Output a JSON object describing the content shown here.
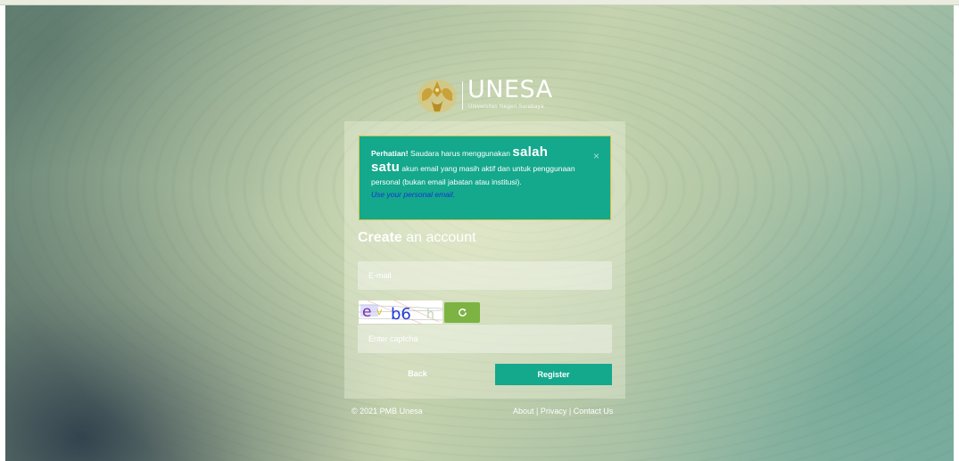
{
  "brand": {
    "name": "UNESA",
    "subtitle": "Universitas Negeri Surabaya"
  },
  "alert": {
    "prefix_bold": "Perhatian!",
    "text1": " Saudara harus menggunakan ",
    "emphasis1": "salah",
    "emphasis2": "satu",
    "text2": " akun email yang masih aktif dan untuk penggunaan personal (bukan email jabatan atau institusi).",
    "hint": "Use your personal email.",
    "close_label": "×"
  },
  "form": {
    "title_bold": "Create",
    "title_rest": " an account",
    "email_placeholder": "E-mail",
    "captcha_text": "e v b6 h",
    "refresh_icon": "refresh-icon",
    "captcha_placeholder": "Enter captcha",
    "back_label": "Back",
    "register_label": "Register"
  },
  "footer": {
    "copyright": "© 2021 PMB Unesa",
    "links": [
      "About",
      "Privacy",
      "Contact Us"
    ],
    "separator": " | "
  },
  "colors": {
    "accent": "#14a88c",
    "refresh": "#7cb342",
    "hint": "#1637d6"
  }
}
